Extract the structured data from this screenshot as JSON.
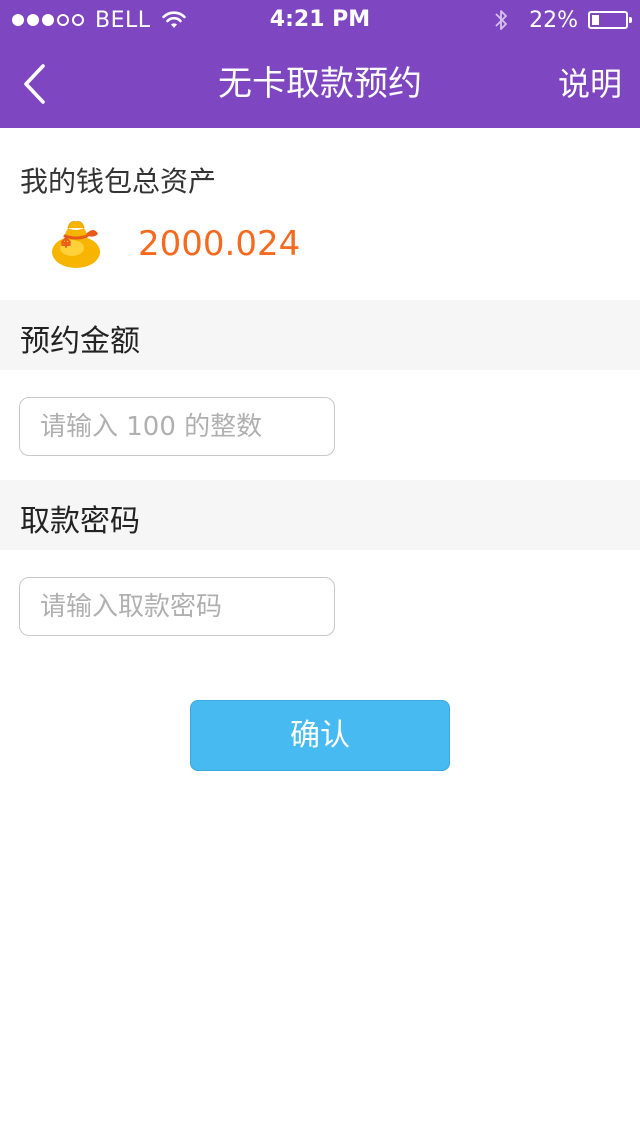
{
  "status_bar": {
    "signal_filled": 3,
    "signal_total": 5,
    "carrier": "BELL",
    "wifi_icon": "wifi-icon",
    "time": "4:21 PM",
    "bluetooth_icon": "bluetooth-icon",
    "battery_percent_text": "22%",
    "battery_level": 0.22
  },
  "nav": {
    "back_icon": "chevron-left-icon",
    "title": "无卡取款预约",
    "right_label": "说明"
  },
  "assets": {
    "label": "我的钱包总资产",
    "icon": "money-bag-icon",
    "value": "2000.024"
  },
  "amount_section": {
    "label": "预约金额",
    "input_value": "",
    "input_placeholder": "请输入 100 的整数"
  },
  "password_section": {
    "label": "取款密码",
    "input_value": "",
    "input_placeholder": "请输入取款密码"
  },
  "confirm_button": {
    "label": "确认"
  },
  "colors": {
    "header_bg": "#7e46c0",
    "value_orange": "#f56a1f",
    "button_blue": "#47bbf1",
    "section_bg": "#f6f6f6"
  }
}
